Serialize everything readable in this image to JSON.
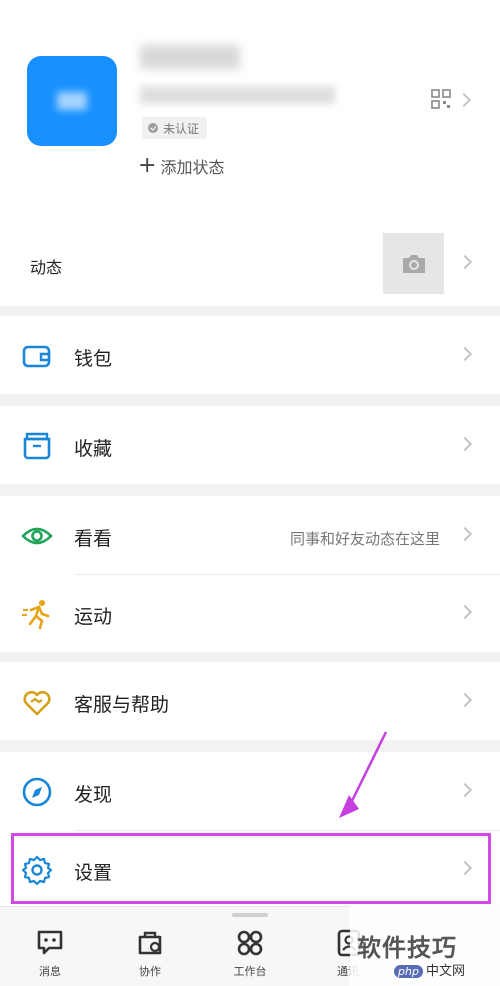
{
  "profile": {
    "verify_badge": "未认证",
    "add_status": "添加状态"
  },
  "moments": {
    "label": "动态"
  },
  "menu": {
    "wallet": "钱包",
    "favorites": "收藏",
    "watch": "看看",
    "watch_sub": "同事和好友动态在这里",
    "sports": "运动",
    "support": "客服与帮助",
    "discover": "发现",
    "settings": "设置"
  },
  "tabs": [
    "消息",
    "协作",
    "工作台",
    "通讯"
  ],
  "watermark": {
    "text": "软件技巧",
    "logo_badge": "php",
    "logo_text": "中文网"
  },
  "colors": {
    "avatar": "#1890ff",
    "wallet_icon": "#1a86d8",
    "favorites_icon": "#1a86d8",
    "watch_icon": "#1fa45a",
    "sports_icon": "#e8a317",
    "support_icon": "#d4a017",
    "discover_icon": "#1a86d8",
    "settings_icon": "#1a86d8",
    "highlight": "#d04be3"
  }
}
